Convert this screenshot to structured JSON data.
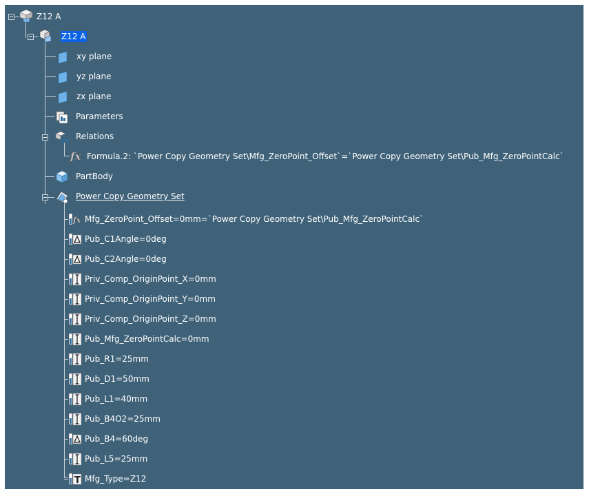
{
  "tree": {
    "root": {
      "label": "Z12 A",
      "icon": "product-icon"
    },
    "part": {
      "label": "Z12 A",
      "icon": "part-icon",
      "selected": true
    },
    "planes": [
      {
        "label": "xy plane",
        "icon": "plane-icon"
      },
      {
        "label": "yz plane",
        "icon": "plane-icon"
      },
      {
        "label": "zx plane",
        "icon": "plane-icon"
      }
    ],
    "parameters": {
      "label": "Parameters",
      "icon": "parameters-icon"
    },
    "relations": {
      "label": "Relations",
      "icon": "relations-icon",
      "formula": {
        "label": "Formula.2: `Power Copy Geometry Set\\Mfg_ZeroPoint_Offset`=`Power Copy Geometry Set\\Pub_Mfg_ZeroPointCalc`",
        "icon": "formula-icon"
      }
    },
    "partbody": {
      "label": "PartBody",
      "icon": "partbody-icon"
    },
    "geoset": {
      "label": "Power Copy Geometry Set",
      "icon": "geometry-set-icon",
      "items": [
        {
          "label": "Mfg_ZeroPoint_Offset=0mm=`Power Copy Geometry Set\\Pub_Mfg_ZeroPointCalc`",
          "icon": "formula-parameter-icon"
        },
        {
          "label": "Pub_C1Angle=0deg",
          "icon": "angle-parameter-icon"
        },
        {
          "label": "Pub_C2Angle=0deg",
          "icon": "angle-parameter-icon"
        },
        {
          "label": "Priv_Comp_OriginPoint_X=0mm",
          "icon": "length-parameter-icon"
        },
        {
          "label": "Priv_Comp_OriginPoint_Y=0mm",
          "icon": "length-parameter-icon"
        },
        {
          "label": "Priv_Comp_OriginPoint_Z=0mm",
          "icon": "length-parameter-icon"
        },
        {
          "label": "Pub_Mfg_ZeroPointCalc=0mm",
          "icon": "length-parameter-icon"
        },
        {
          "label": "Pub_R1=25mm",
          "icon": "length-parameter-icon"
        },
        {
          "label": "Pub_D1=50mm",
          "icon": "length-parameter-icon"
        },
        {
          "label": "Pub_L1=40mm",
          "icon": "length-parameter-icon"
        },
        {
          "label": "Pub_B4O2=25mm",
          "icon": "length-parameter-icon"
        },
        {
          "label": "Pub_B4=60deg",
          "icon": "angle-parameter-icon"
        },
        {
          "label": "Pub_L5=25mm",
          "icon": "length-parameter-icon"
        },
        {
          "label": "Mfg_Type=Z12",
          "icon": "string-parameter-icon"
        }
      ]
    }
  }
}
